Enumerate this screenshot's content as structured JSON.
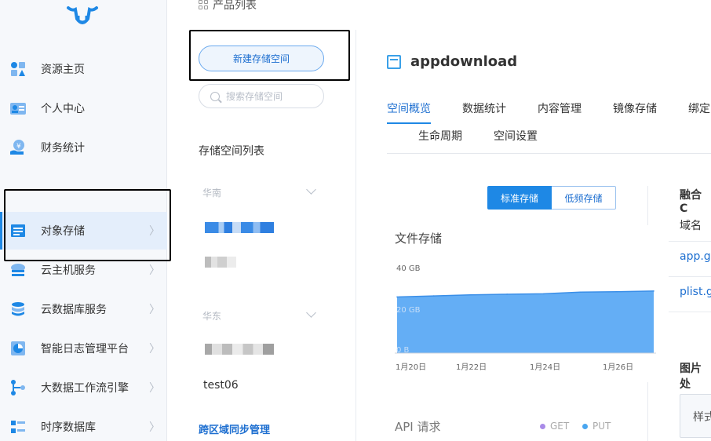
{
  "breadcrumb": {
    "label": "产品列表"
  },
  "sidebar": {
    "items": [
      {
        "label": "资源主页",
        "icon": "home-resource-icon"
      },
      {
        "label": "个人中心",
        "icon": "id-card-icon"
      },
      {
        "label": "财务统计",
        "icon": "yuan-hand-icon"
      },
      {
        "label": "对象存储",
        "icon": "object-storage-icon",
        "active": true
      },
      {
        "label": "云主机服务",
        "icon": "cloud-host-icon"
      },
      {
        "label": "云数据库服务",
        "icon": "cloud-database-icon"
      },
      {
        "label": "智能日志管理平台",
        "icon": "pie-chart-icon"
      },
      {
        "label": "大数据工作流引擎",
        "icon": "workflow-icon"
      },
      {
        "label": "时序数据库",
        "icon": "time-series-icon"
      }
    ]
  },
  "buckets_panel": {
    "new_button": "新建存储空间",
    "search_placeholder": "搜索存储空间",
    "list_title": "存储空间列表",
    "regions": [
      {
        "name": "华南"
      },
      {
        "name": "华东"
      }
    ],
    "visible_bucket": "test06",
    "cross_region_link": "跨区域同步管理"
  },
  "main": {
    "bucket_name": "appdownload",
    "tabs": [
      "空间概览",
      "数据统计",
      "内容管理",
      "镜像存储",
      "绑定",
      "生命周期",
      "空间设置"
    ],
    "active_tab": "空间概览",
    "storage_toggle": {
      "standard": "标准存储",
      "low_freq": "低频存储"
    },
    "file_storage_title": "文件存储",
    "api_title": "API 请求",
    "api_legend": [
      {
        "name": "GET",
        "color": "#a98be8"
      },
      {
        "name": "PUT",
        "color": "#4aa6f0"
      }
    ]
  },
  "chart_data": {
    "type": "area",
    "title": "文件存储",
    "y_ticks": [
      "40 GB",
      "20 GB",
      "0 B"
    ],
    "x_ticks": [
      "1月20日",
      "1月22日",
      "1月24日",
      "1月26日"
    ],
    "ylim": [
      0,
      40
    ],
    "series": [
      {
        "x": [
          "1月20日",
          "1月21日",
          "1月22日",
          "1月23日",
          "1月24日",
          "1月25日",
          "1月26日",
          "1月27日"
        ],
        "values": [
          26.5,
          27.0,
          27.5,
          27.8,
          28.0,
          28.8,
          29.0,
          29.3
        ],
        "color": "#64aef5"
      }
    ]
  },
  "fusion_panel": {
    "heading": "融合 C",
    "domain_label": "域名",
    "domains": [
      "app.gu",
      "plist.g"
    ],
    "image_heading": "图片处",
    "style_button": "样式"
  }
}
